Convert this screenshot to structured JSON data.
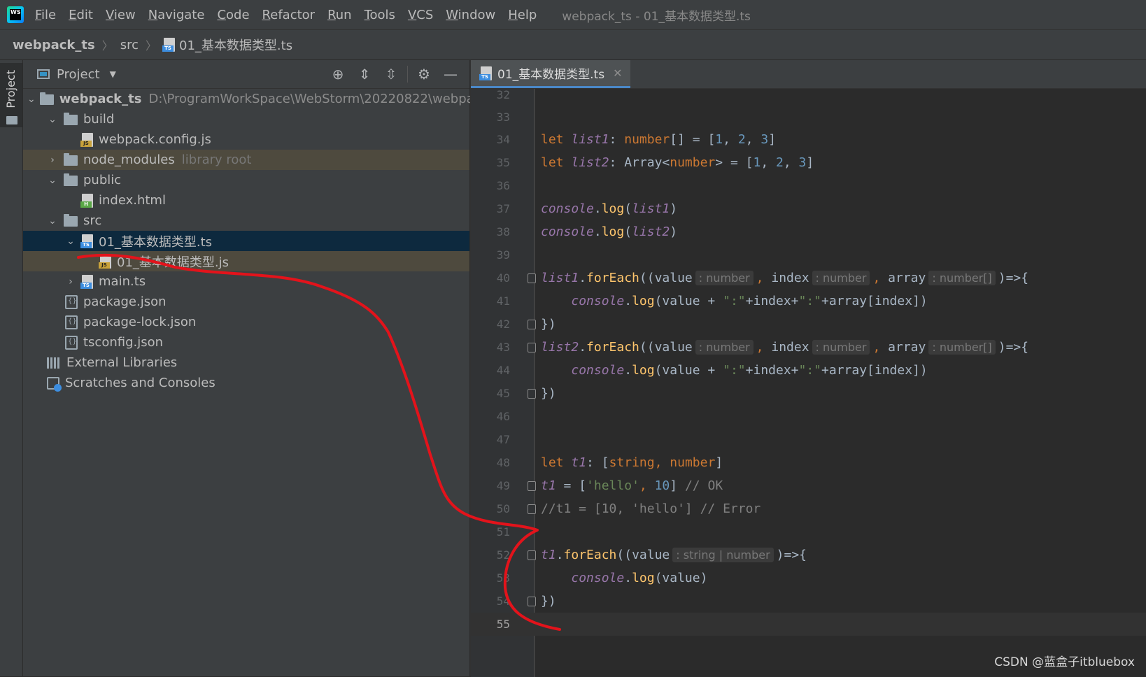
{
  "menu": {
    "items": [
      "File",
      "Edit",
      "View",
      "Navigate",
      "Code",
      "Refactor",
      "Run",
      "Tools",
      "VCS",
      "Window",
      "Help"
    ],
    "window_title": "webpack_ts - 01_基本数据类型.ts"
  },
  "breadcrumb": {
    "project": "webpack_ts",
    "folder": "src",
    "file": "01_基本数据类型.ts"
  },
  "toolstrip": {
    "label": "Project"
  },
  "project_panel": {
    "title": "Project",
    "tree": {
      "root_name": "webpack_ts",
      "root_path": "D:\\ProgramWorkSpace\\WebStorm\\20220822\\webpac",
      "build": "build",
      "webpack_config": "webpack.config.js",
      "node_modules": "node_modules",
      "node_modules_hint": "library root",
      "public": "public",
      "index_html": "index.html",
      "src": "src",
      "ts_file": "01_基本数据类型.ts",
      "js_file": "01_基本数据类型.js",
      "main_ts": "main.ts",
      "package_json": "package.json",
      "package_lock": "package-lock.json",
      "tsconfig": "tsconfig.json",
      "external_libs": "External Libraries",
      "scratches": "Scratches and Consoles"
    }
  },
  "editor": {
    "tab_label": "01_基本数据类型.ts",
    "line_numbers": [
      "32",
      "33",
      "34",
      "35",
      "36",
      "37",
      "38",
      "39",
      "40",
      "41",
      "42",
      "43",
      "44",
      "45",
      "46",
      "47",
      "48",
      "49",
      "50",
      "51",
      "52",
      "53",
      "54",
      "55"
    ],
    "hints": {
      "number": ": number",
      "number_array": ": number[]",
      "string_or_number": ": string | number"
    }
  },
  "watermark": "CSDN @蓝盒子itbluebox",
  "colors": {
    "annotation": "#e3131b",
    "selection": "#0d293e",
    "keyword": "#cc7832"
  }
}
